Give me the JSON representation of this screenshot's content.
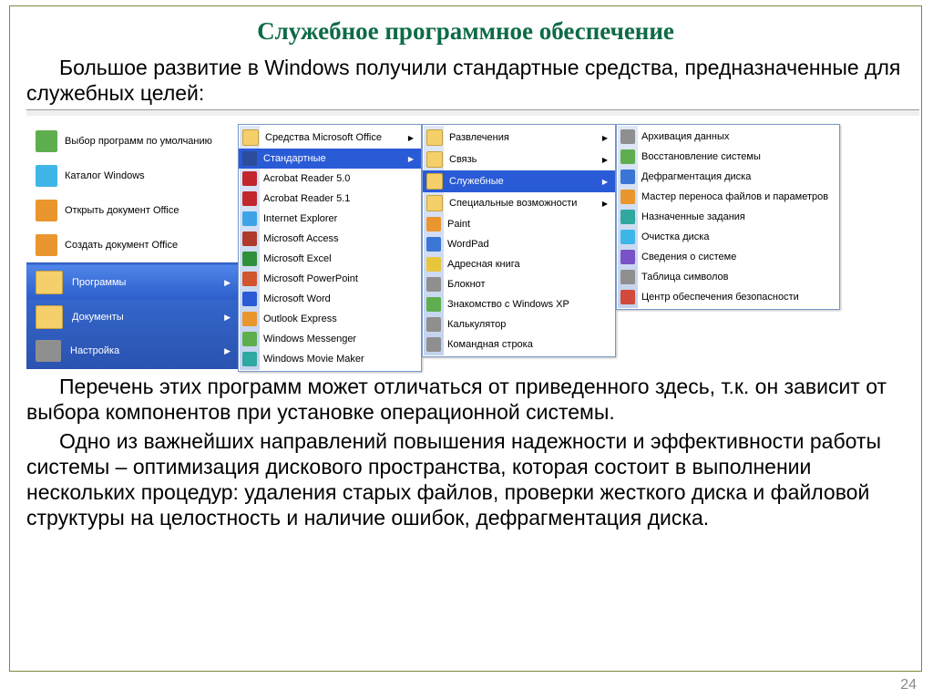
{
  "title": "Служебное программное обеспечение",
  "para1": "Большое развитие в Windows получили стандартные средства, предназначенные для служебных целей:",
  "para2": "Перечень этих программ может отличаться от приведенного здесь, т.к. он зависит от выбора компонентов при установке операционной системы.",
  "para3": "Одно из важнейших направлений повышения надежности и эффективности работы системы – оптимизация дискового пространства, которая состоит в выполнении нескольких процедур: удаления старых файлов, проверки жесткого диска и файловой структуры на целостность и наличие ошибок, дефрагментация диска.",
  "slide_num": "24",
  "start": {
    "items": [
      "Выбор программ по умолчанию",
      "Каталог Windows",
      "Открыть документ Office",
      "Создать документ Office"
    ],
    "stripe": [
      "Программы",
      "Документы",
      "Настройка"
    ]
  },
  "programs": [
    {
      "label": "Средства Microsoft Office",
      "arrow": true
    },
    {
      "label": "Стандартные",
      "arrow": true,
      "sel": true
    },
    {
      "label": "Acrobat Reader 5.0",
      "arrow": false
    },
    {
      "label": "Acrobat Reader 5.1",
      "arrow": false
    },
    {
      "label": "Internet Explorer",
      "arrow": false
    },
    {
      "label": "Microsoft Access",
      "arrow": false
    },
    {
      "label": "Microsoft Excel",
      "arrow": false
    },
    {
      "label": "Microsoft PowerPoint",
      "arrow": false
    },
    {
      "label": "Microsoft Word",
      "arrow": false
    },
    {
      "label": "Outlook Express",
      "arrow": false
    },
    {
      "label": "Windows Messenger",
      "arrow": false
    },
    {
      "label": "Windows Movie Maker",
      "arrow": false
    }
  ],
  "standard": [
    {
      "label": "Развлечения",
      "arrow": true
    },
    {
      "label": "Связь",
      "arrow": true
    },
    {
      "label": "Служебные",
      "arrow": true,
      "sel": true
    },
    {
      "label": "Специальные возможности",
      "arrow": true
    },
    {
      "label": "Paint",
      "arrow": false
    },
    {
      "label": "WordPad",
      "arrow": false
    },
    {
      "label": "Адресная книга",
      "arrow": false
    },
    {
      "label": "Блокнот",
      "arrow": false
    },
    {
      "label": "Знакомство с Windows XP",
      "arrow": false
    },
    {
      "label": "Калькулятор",
      "arrow": false
    },
    {
      "label": "Командная строка",
      "arrow": false
    }
  ],
  "system": [
    "Архивация данных",
    "Восстановление системы",
    "Дефрагментация диска",
    "Мастер переноса файлов и параметров",
    "Назначенные задания",
    "Очистка диска",
    "Сведения о системе",
    "Таблица символов",
    "Центр обеспечения безопасности"
  ]
}
